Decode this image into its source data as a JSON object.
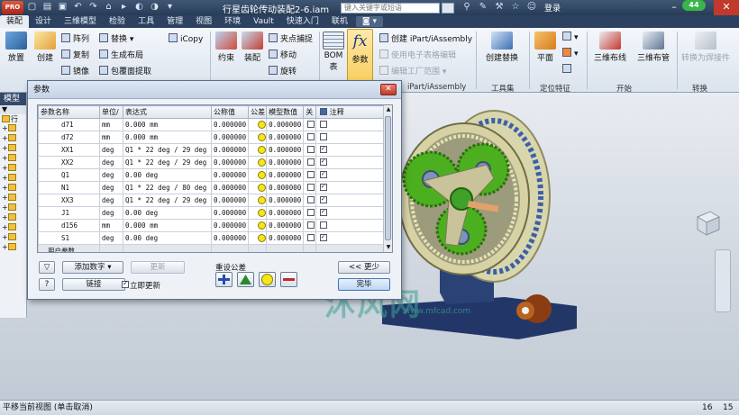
{
  "window": {
    "title": "行星齿轮传动装配2-6.iam",
    "search_placeholder": "键入关键字或短语",
    "login": "登录",
    "badge": "44",
    "app_logo": "PRO"
  },
  "tabs": [
    "装配",
    "设计",
    "三维模型",
    "检验",
    "工具",
    "管理",
    "视图",
    "环境",
    "Vault",
    "快速入门",
    "联机"
  ],
  "active_tab": "装配",
  "ribbon": {
    "place": "放置",
    "create": "创建",
    "pattern": "阵列",
    "copy": "复制",
    "mirror": "镜像",
    "replace": "替换",
    "generate_layout": "生成布局",
    "shrinkwrap": "包覆面提取",
    "icopy": "iCopy",
    "constrain": "约束",
    "assemble": "装配",
    "grip_snap": "夹点捕捉",
    "move": "移动",
    "rotate": "旋转",
    "bom": "BOM",
    "bom_sub": "表",
    "parameters": "参数",
    "create_ipart": "创建 iPart/iAssembly",
    "use_spreadsheet": "使用电子表格编辑",
    "edit_factory": "编辑工厂范围",
    "ipart_group": "iPart/iAssembly",
    "create_replace": "创建替换",
    "tool_group": "工具集",
    "plane": "平面",
    "work_group": "定位特征",
    "route_3d": "三维布线",
    "harness_3d": "三维布管",
    "convert_weld": "转换为焊接件",
    "start_group": "开始",
    "convert_group": "转换"
  },
  "browser": {
    "header": "模型",
    "rows": [
      "行",
      "",
      "",
      "",
      "",
      "",
      "",
      "",
      "",
      "",
      "",
      "",
      "",
      "",
      ""
    ]
  },
  "dialog": {
    "title": "参数",
    "close": "✕",
    "columns": [
      "参数名称",
      "单位/",
      "表达式",
      "公称值",
      "公差",
      "模型数值",
      "关",
      "注释"
    ],
    "rows": [
      {
        "name": "d71",
        "unit": "mm",
        "expr": "0.000 mm",
        "nominal": "0.000000",
        "model": "0.000000",
        "key": false,
        "export": false
      },
      {
        "name": "d72",
        "unit": "mm",
        "expr": "0.000 mm",
        "nominal": "0.000000",
        "model": "0.000000",
        "key": false,
        "export": false
      },
      {
        "name": "XX1",
        "unit": "deg",
        "expr": "Q1 * 22 deg / 29 deg",
        "nominal": "0.000000",
        "model": "0.000000",
        "key": false,
        "export": true
      },
      {
        "name": "XX2",
        "unit": "deg",
        "expr": "Q1 * 22 deg / 29 deg",
        "nominal": "0.000000",
        "model": "0.000000",
        "key": false,
        "export": true
      },
      {
        "name": "Q1",
        "unit": "deg",
        "expr": "0.00 deg",
        "nominal": "0.000000",
        "model": "0.000000",
        "key": false,
        "export": true
      },
      {
        "name": "N1",
        "unit": "deg",
        "expr": "Q1 * 22 deg / 80 deg",
        "nominal": "0.000000",
        "model": "0.000000",
        "key": false,
        "export": true
      },
      {
        "name": "XX3",
        "unit": "deg",
        "expr": "Q1 * 22 deg / 29 deg",
        "nominal": "0.000000",
        "model": "0.000000",
        "key": false,
        "export": true
      },
      {
        "name": "J1",
        "unit": "deg",
        "expr": "0.00 deg",
        "nominal": "0.000000",
        "model": "0.000000",
        "key": false,
        "export": true
      },
      {
        "name": "d156",
        "unit": "mm",
        "expr": "0.000 mm",
        "nominal": "0.000000",
        "model": "0.000000",
        "key": false,
        "export": false
      },
      {
        "name": "S1",
        "unit": "deg",
        "expr": "0.00 deg",
        "nominal": "0.000000",
        "model": "0.000000",
        "key": false,
        "export": true
      }
    ],
    "user_params": "用户参数",
    "add_number": "添加数字",
    "update": "更新",
    "link": "链接",
    "immediate_update": "立即更新",
    "reset_tolerance": "重设公差",
    "less": "<< 更少",
    "done": "完毕"
  },
  "watermark": "沐风网",
  "watermark_url": "www.mfcad.com",
  "status": {
    "text": "平移当前视图 (单击取消)",
    "n1": "16",
    "n2": "15"
  },
  "colors": {
    "title_bar": "#283c56",
    "ribbon_bg": "#e4eaf2",
    "gear_green": "#4caf1f",
    "base_blue": "#253c72",
    "ring_cream": "#dcdcb4",
    "highlight_yellow": "#f6e51c"
  }
}
